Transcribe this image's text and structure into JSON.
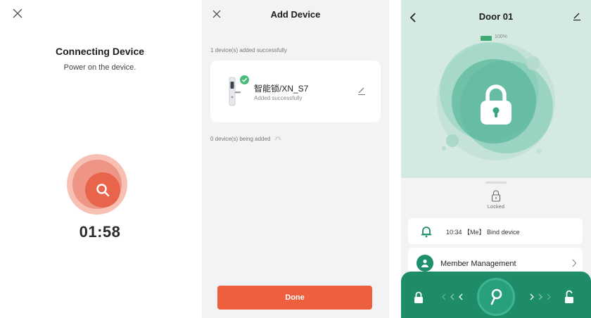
{
  "connecting": {
    "title": "Connecting Device",
    "subtitle": "Power on the device.",
    "countdown": "01:58",
    "colors": {
      "halo": "#f7c0b2",
      "ring": "#ee9585",
      "core": "#e8644a"
    },
    "icons": [
      "close-icon",
      "search-icon"
    ]
  },
  "add_device": {
    "title": "Add Device",
    "added_summary": "1 device(s) added successfully",
    "device": {
      "name": "智能锁/XN_S7",
      "status": "Added successfully"
    },
    "adding_summary": "0 device(s) being added",
    "done_label": "Done",
    "colors": {
      "done": "#ed5f3d",
      "check": "#4cb87a"
    },
    "icons": [
      "close-icon",
      "smart-lock-thumbnail-icon",
      "check-badge-icon",
      "edit-icon",
      "loading-spinner-icon"
    ]
  },
  "door": {
    "title": "Door 01",
    "battery_pct": "100%",
    "battery_level": 1.0,
    "lock_state": "Locked",
    "log": {
      "text": "10:34 【Me】 Bind device"
    },
    "member": {
      "label": "Member Management"
    },
    "colors": {
      "hero_bg": "#d5e9e3",
      "brand": "#1e8c69",
      "battery": "#3cab73"
    },
    "icons": [
      "back-icon",
      "edit-icon",
      "battery-icon",
      "padlock-icon",
      "bell-icon",
      "user-icon",
      "chevron-right-icon",
      "lock-icon",
      "key-icon",
      "unlock-icon"
    ]
  }
}
